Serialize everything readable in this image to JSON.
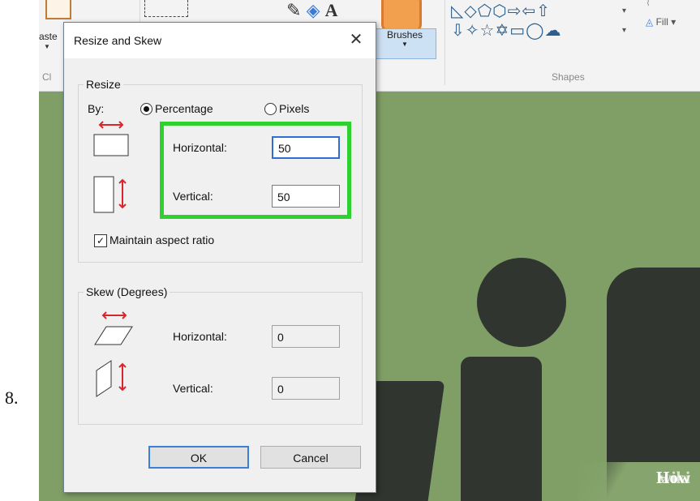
{
  "step_number": "8.",
  "ribbon": {
    "paste_label": "aste",
    "clipboard_label": "Cl",
    "brushes_label": "Brushes",
    "shapes_label": "Shapes",
    "fill_label": "Fill",
    "tools_text_icon": "A"
  },
  "dialog": {
    "title": "Resize and Skew",
    "close_label": "✕",
    "resize": {
      "legend": "Resize",
      "by_label": "By:",
      "percentage_label": "Percentage",
      "pixels_label": "Pixels",
      "selected_unit": "Percentage",
      "horizontal_label": "Horizontal:",
      "horizontal_value": "50",
      "vertical_label": "Vertical:",
      "vertical_value": "50",
      "maintain_aspect_label": "Maintain aspect ratio",
      "maintain_aspect_checked": true
    },
    "skew": {
      "legend": "Skew (Degrees)",
      "horizontal_label": "Horizontal:",
      "horizontal_value": "0",
      "vertical_label": "Vertical:",
      "vertical_value": "0"
    },
    "ok_label": "OK",
    "cancel_label": "Cancel"
  },
  "watermark": {
    "wiki": "wiki",
    "how": "How"
  },
  "colors": {
    "canvas_green": "#7f9f66",
    "logo_dark": "#30352f",
    "highlight_green": "#2ed12f",
    "focus_blue": "#2f6fd3",
    "arrow_red": "#d9262c"
  }
}
